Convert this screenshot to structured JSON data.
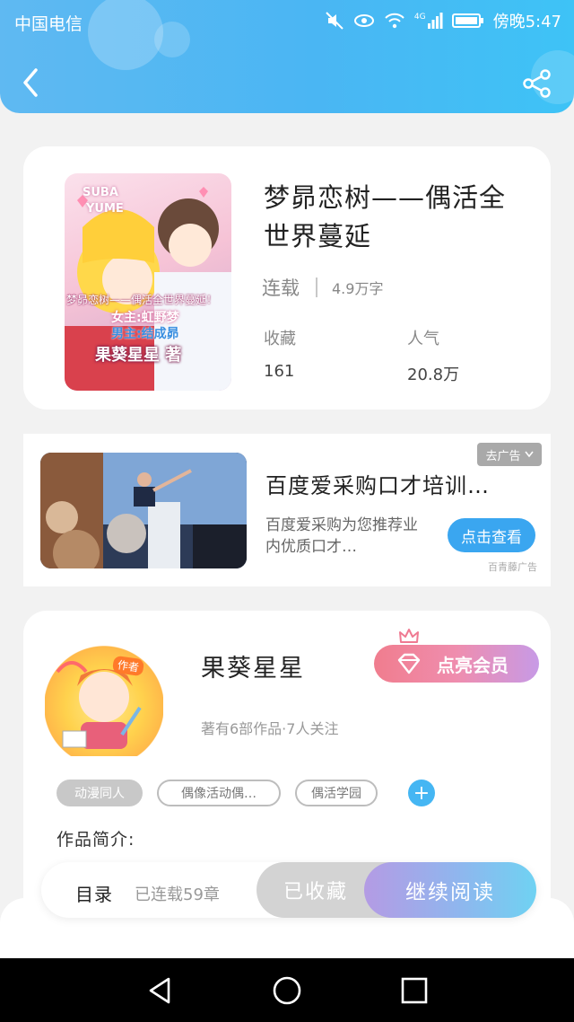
{
  "status_bar": {
    "carrier": "中国电信",
    "network": "4G",
    "time": "傍晚5:47"
  },
  "book": {
    "title": "梦昴恋树——偶活全世界蔓延",
    "status": "连载",
    "word_count": "4.9万字",
    "stats": [
      {
        "label": "收藏",
        "value": "161"
      },
      {
        "label": "人气",
        "value": "20.8万"
      }
    ],
    "cover_text": {
      "line_suba": "SUBA",
      "line_yume": "YUME",
      "line_title": "梦昴恋树——偶活全世界蔓延！",
      "line_heroine": "女主:虹野梦",
      "line_hero": "男主:结成昴",
      "line_author": "果葵星星 著"
    }
  },
  "ad": {
    "tag_label": "去广告",
    "title": "百度爱采购口才培训…",
    "description": "百度爱采购为您推荐业内优质口才…",
    "button_label": "点击查看",
    "source": "百青藤广告"
  },
  "author": {
    "avatar_badge": "作者",
    "name": "果葵星星",
    "vip_button": "点亮会员",
    "info": "著有6部作品·7人关注",
    "tags": [
      "动漫同人",
      "偶像活动偶…",
      "偶活学园"
    ],
    "add_tag_symbol": "+",
    "intro_label": "作品简介:"
  },
  "read_bar": {
    "toc_label": "目录",
    "chapter_count": "已连载59章",
    "collected_label": "已收藏",
    "continue_label": "继续阅读"
  },
  "colors": {
    "header_blue": "#4ab6f3",
    "ad_button": "#3aa6f0",
    "vip_pink": "#ef8dae",
    "continue_gradient_end": "#6fd2f2"
  }
}
